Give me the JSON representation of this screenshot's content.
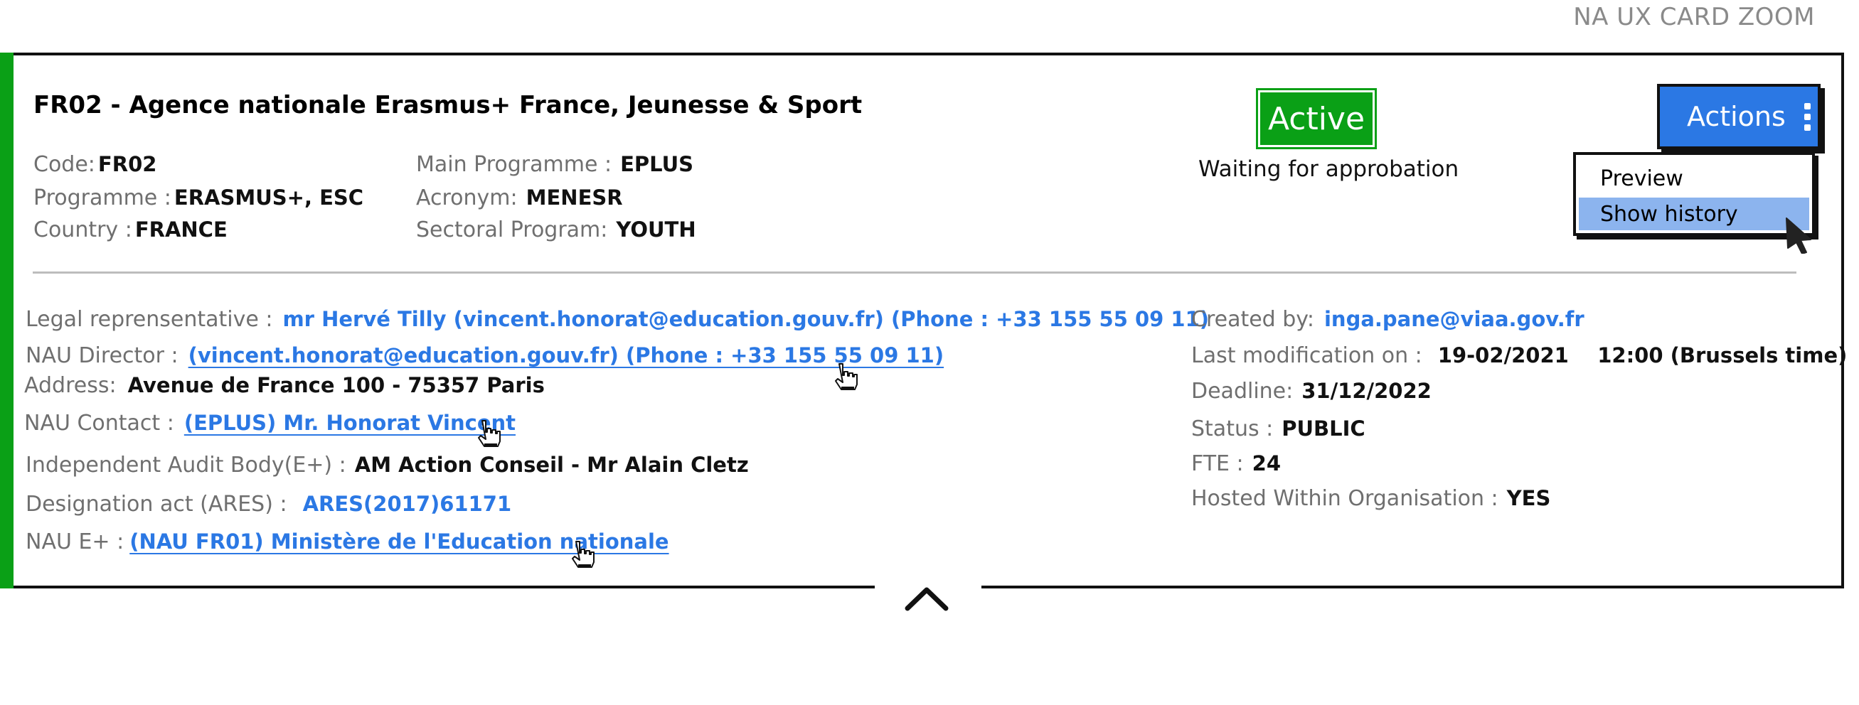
{
  "page_label": "NA UX CARD ZOOM",
  "card": {
    "title": "FR02 - Agence nationale Erasmus+ France, Jeunesse & Sport",
    "status": {
      "badge": "Active",
      "subtext": "Waiting for approbation"
    },
    "actions": {
      "button_label": "Actions",
      "menu": [
        {
          "label": "Preview",
          "selected": false
        },
        {
          "label": "Show history",
          "selected": true
        }
      ]
    },
    "summary_left": [
      {
        "label": "Code:",
        "value": "FR02"
      },
      {
        "label": "Programme :",
        "value": "ERASMUS+, ESC"
      },
      {
        "label": "Country :",
        "value": "FRANCE"
      }
    ],
    "summary_mid": [
      {
        "label": "Main Programme :",
        "value": "EPLUS"
      },
      {
        "label": "Acronym:",
        "value": "MENESR"
      },
      {
        "label": "Sectoral Program:",
        "value": "YOUTH"
      }
    ],
    "details_left": {
      "legal_rep": {
        "label": "Legal reprensentative :",
        "value": "mr Hervé Tilly (vincent.honorat@education.gouv.fr)  (Phone : +33 155 55 09 11)"
      },
      "nau_director": {
        "label": "NAU Director :",
        "value": "(vincent.honorat@education.gouv.fr)  (Phone : +33 155 55 09 11)"
      },
      "address": {
        "label": "Address:",
        "value": "Avenue de France 100 - 75357 Paris"
      },
      "nau_contact": {
        "label": "NAU Contact :",
        "value": "(EPLUS) Mr. Honorat Vincent"
      },
      "audit_body": {
        "label": "Independent Audit Body(E+) :",
        "value": "AM Action Conseil - Mr Alain Cletz"
      },
      "designation": {
        "label": "Designation act (ARES) :",
        "value": "ARES(2017)61171"
      },
      "nau_eplus": {
        "label": "NAU E+ :",
        "value": "(NAU FR01) Ministère de l'Education nationale"
      }
    },
    "details_right": {
      "created_by": {
        "label": "Created by:",
        "value": "inga.pane@viaa.gov.fr"
      },
      "last_mod": {
        "label": "Last modification on :",
        "value": "19-02/2021    12:00 (Brussels time)"
      },
      "deadline": {
        "label": "Deadline:",
        "value": "31/12/2022"
      },
      "status": {
        "label": "Status :",
        "value": "PUBLIC"
      },
      "fte": {
        "label": "FTE :",
        "value": "24"
      },
      "hosted": {
        "label": "Hosted Within Organisation :",
        "value": "YES"
      }
    }
  },
  "colors": {
    "accent_green": "#0aa016",
    "link_blue": "#2b78e4",
    "menu_selected": "#8cb4ee"
  },
  "icons": [
    "kebab-icon",
    "hand-cursor-icon",
    "arrow-cursor-icon",
    "chevron-up-icon"
  ]
}
